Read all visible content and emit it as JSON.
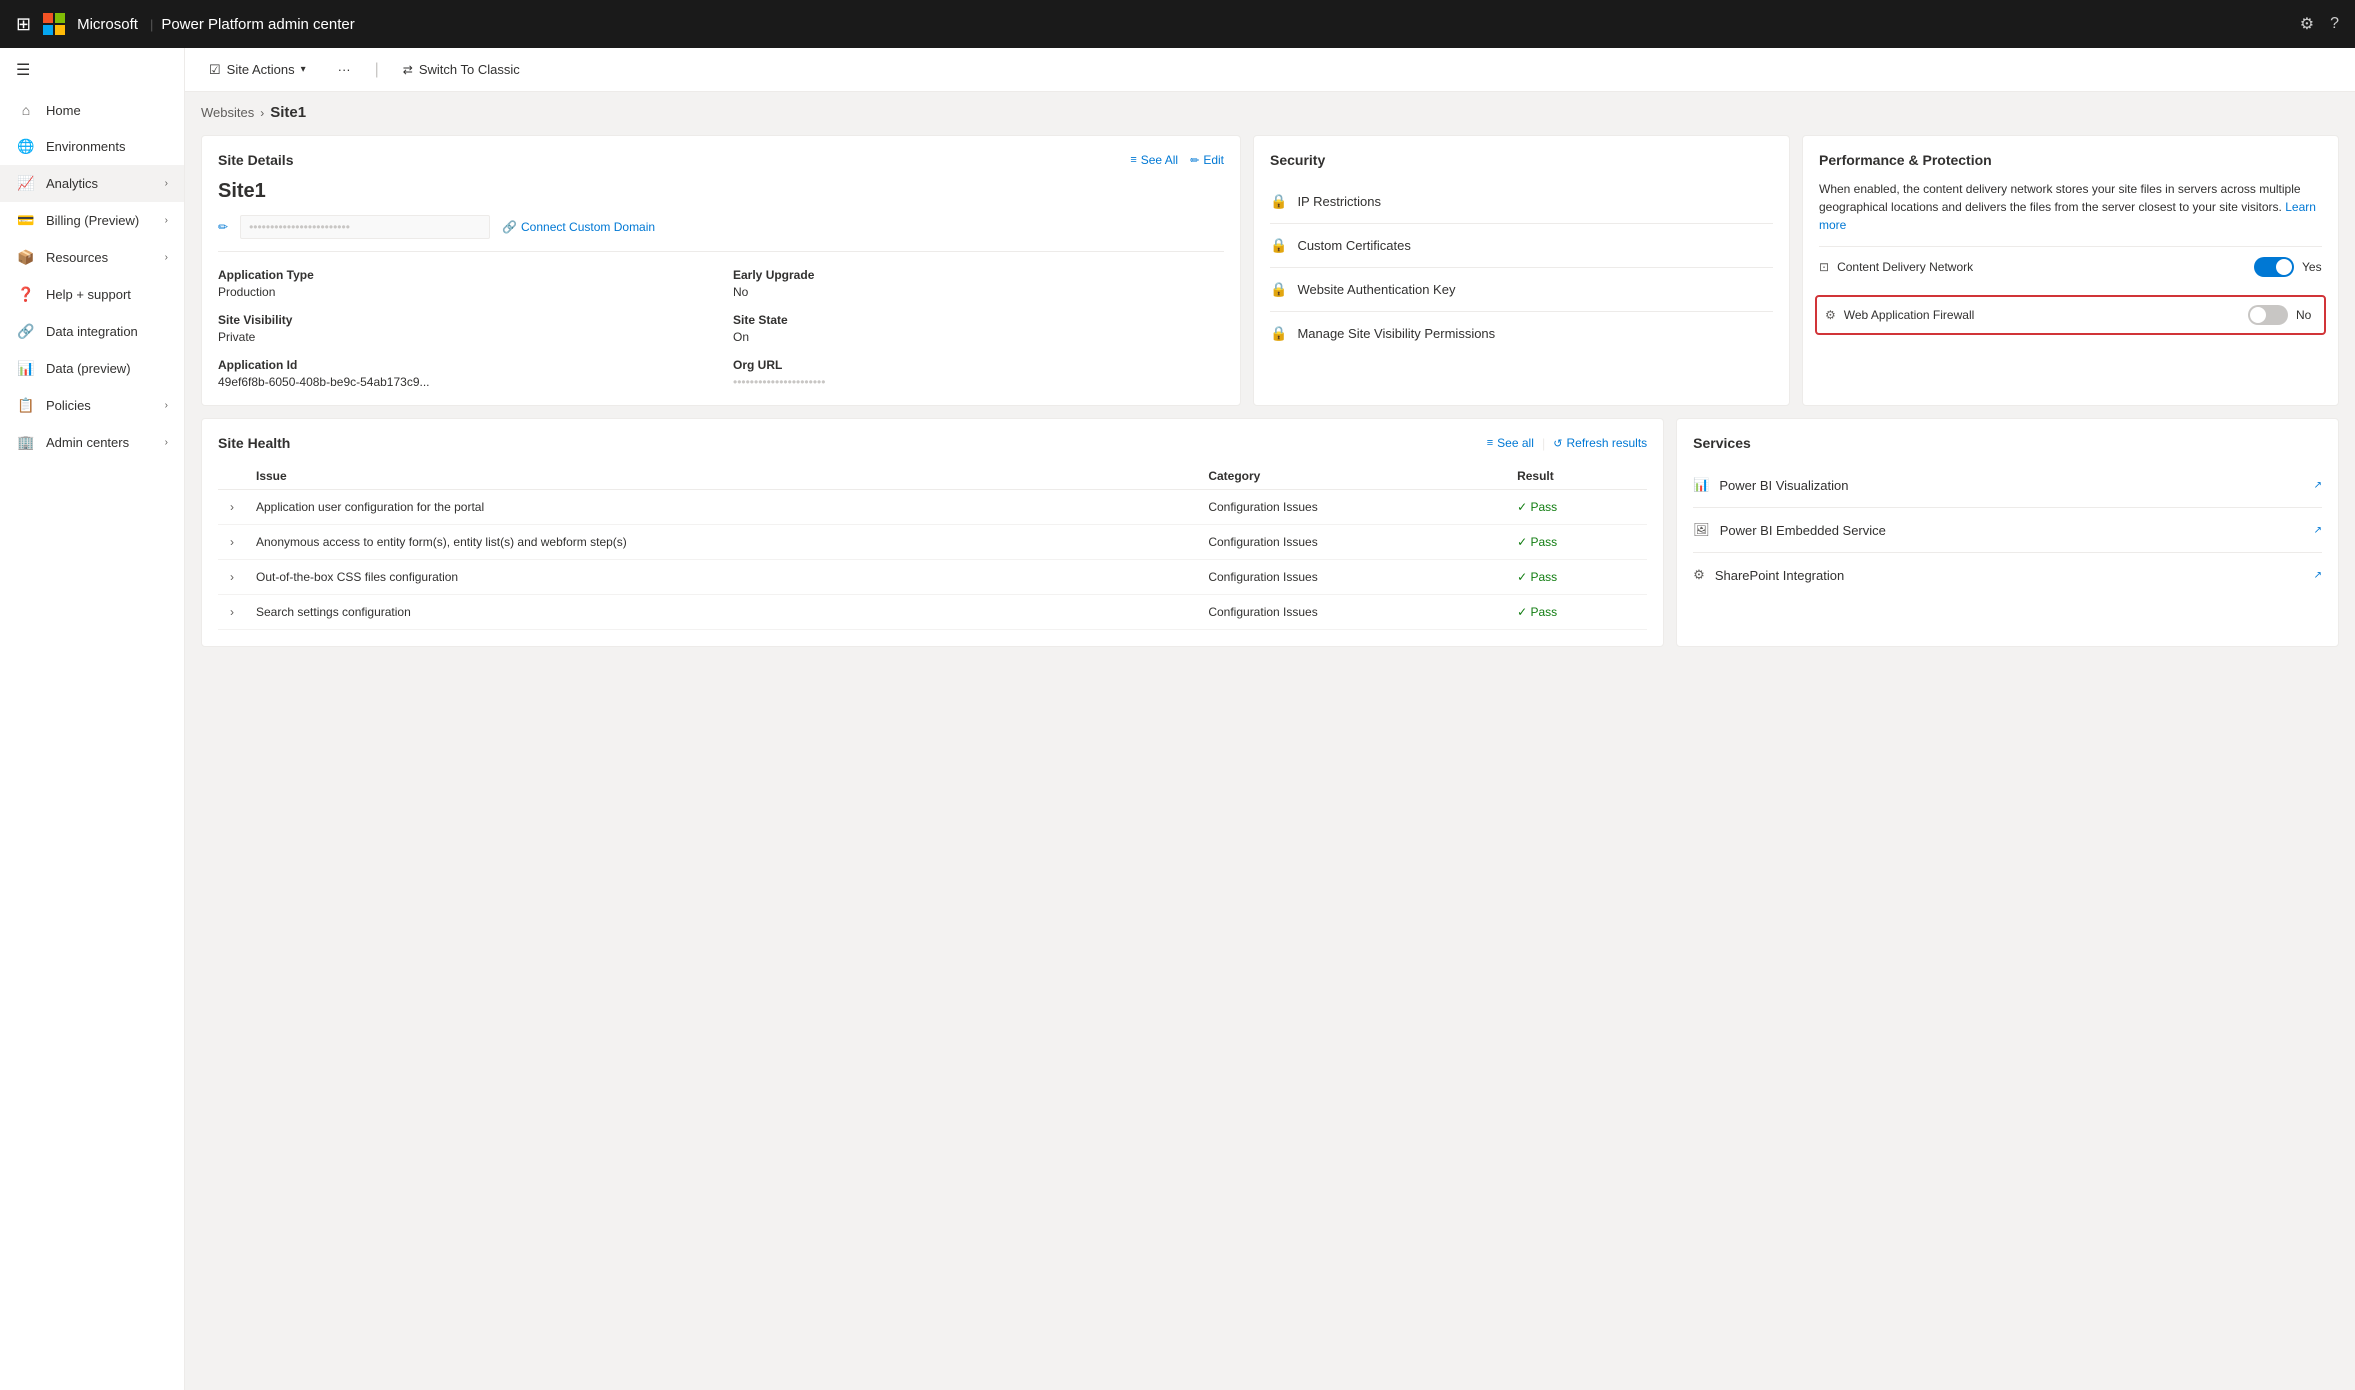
{
  "topbar": {
    "brand": "Microsoft",
    "title": "Power Platform admin center",
    "waffle_icon": "⊞",
    "settings_icon": "⚙",
    "help_icon": "?"
  },
  "sidebar": {
    "hamburger": "☰",
    "items": [
      {
        "id": "home",
        "label": "Home",
        "icon": "🏠",
        "hasChevron": false
      },
      {
        "id": "environments",
        "label": "Environments",
        "icon": "🌐",
        "hasChevron": false
      },
      {
        "id": "analytics",
        "label": "Analytics",
        "icon": "📈",
        "hasChevron": true
      },
      {
        "id": "billing",
        "label": "Billing (Preview)",
        "icon": "💳",
        "hasChevron": true
      },
      {
        "id": "resources",
        "label": "Resources",
        "icon": "📦",
        "hasChevron": true
      },
      {
        "id": "help",
        "label": "Help + support",
        "icon": "❓",
        "hasChevron": false
      },
      {
        "id": "data-integration",
        "label": "Data integration",
        "icon": "🔗",
        "hasChevron": false
      },
      {
        "id": "data-preview",
        "label": "Data (preview)",
        "icon": "📊",
        "hasChevron": false
      },
      {
        "id": "policies",
        "label": "Policies",
        "icon": "📋",
        "hasChevron": true
      },
      {
        "id": "admin-centers",
        "label": "Admin centers",
        "icon": "🏢",
        "hasChevron": true
      }
    ]
  },
  "toolbar": {
    "site_actions_label": "Site Actions",
    "more_label": "···",
    "switch_classic_label": "Switch To Classic"
  },
  "breadcrumb": {
    "parent": "Websites",
    "current": "Site1"
  },
  "site_details": {
    "title": "Site Details",
    "see_all": "See All",
    "edit": "Edit",
    "site_name": "Site1",
    "url_placeholder": "••••••••••••••••••••••••",
    "connect_domain": "Connect Custom Domain",
    "fields": [
      {
        "label": "Application Type",
        "value": "Production"
      },
      {
        "label": "Early Upgrade",
        "value": "No"
      },
      {
        "label": "Site Visibility",
        "value": "Private"
      },
      {
        "label": "Site State",
        "value": "On"
      },
      {
        "label": "Application Id",
        "value": "49ef6f8b-6050-408b-be9c-54ab173c9..."
      },
      {
        "label": "Org URL",
        "value": "••••••••••••••••••••••••••••"
      }
    ]
  },
  "security": {
    "title": "Security",
    "items": [
      {
        "label": "IP Restrictions",
        "icon": "🔒"
      },
      {
        "label": "Custom Certificates",
        "icon": "🔒"
      },
      {
        "label": "Website Authentication Key",
        "icon": "🔒"
      },
      {
        "label": "Manage Site Visibility Permissions",
        "icon": "🔒"
      }
    ]
  },
  "performance": {
    "title": "Performance & Protection",
    "description": "When enabled, the content delivery network stores your site files in servers across multiple geographical locations and delivers the files from the server closest to your site visitors.",
    "learn_more": "Learn more",
    "toggles": [
      {
        "label": "Content Delivery Network",
        "value": "Yes",
        "state": "on",
        "highlighted": false
      },
      {
        "label": "Web Application Firewall",
        "value": "No",
        "state": "off",
        "highlighted": true
      }
    ]
  },
  "site_health": {
    "title": "Site Health",
    "see_all": "See all",
    "refresh": "Refresh results",
    "columns": [
      "Issue",
      "Category",
      "Result"
    ],
    "rows": [
      {
        "issue": "Application user configuration for the portal",
        "category": "Configuration Issues",
        "result": "Pass"
      },
      {
        "issue": "Anonymous access to entity form(s), entity list(s) and webform step(s)",
        "category": "Configuration Issues",
        "result": "Pass"
      },
      {
        "issue": "Out-of-the-box CSS files configuration",
        "category": "Configuration Issues",
        "result": "Pass"
      },
      {
        "issue": "Search settings configuration",
        "category": "Configuration Issues",
        "result": "Pass"
      }
    ]
  },
  "services": {
    "title": "Services",
    "items": [
      {
        "label": "Power BI Visualization",
        "icon": "📊"
      },
      {
        "label": "Power BI Embedded Service",
        "icon": "🖼"
      },
      {
        "label": "SharePoint Integration",
        "icon": "⚙"
      }
    ]
  }
}
